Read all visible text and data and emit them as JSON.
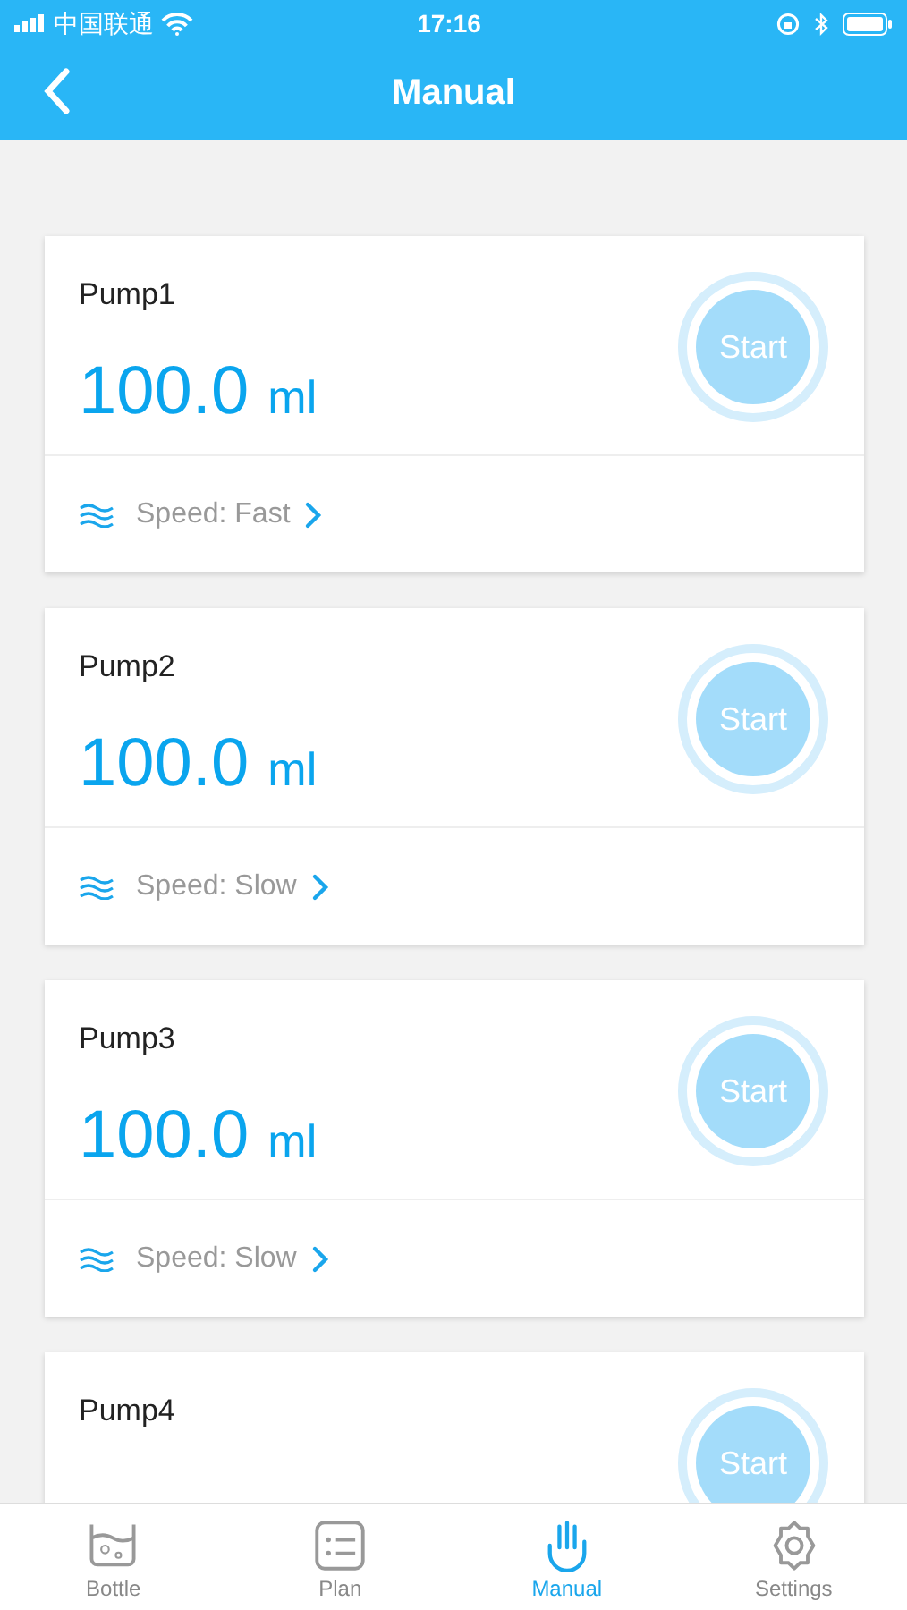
{
  "status_bar": {
    "carrier": "中国联通",
    "time": "17:16"
  },
  "nav": {
    "title": "Manual"
  },
  "pumps": [
    {
      "name": "Pump1",
      "amount": "100.0",
      "unit": "ml",
      "speed": "Speed: Fast",
      "button": "Start"
    },
    {
      "name": "Pump2",
      "amount": "100.0",
      "unit": "ml",
      "speed": "Speed: Slow",
      "button": "Start"
    },
    {
      "name": "Pump3",
      "amount": "100.0",
      "unit": "ml",
      "speed": "Speed: Slow",
      "button": "Start"
    },
    {
      "name": "Pump4",
      "button": "Start"
    }
  ],
  "tabs": [
    {
      "label": "Bottle",
      "kind": "bottle",
      "selected": false
    },
    {
      "label": "Plan",
      "kind": "plan",
      "selected": false
    },
    {
      "label": "Manual",
      "kind": "manual",
      "selected": true
    },
    {
      "label": "Settings",
      "kind": "settings",
      "selected": false
    }
  ]
}
